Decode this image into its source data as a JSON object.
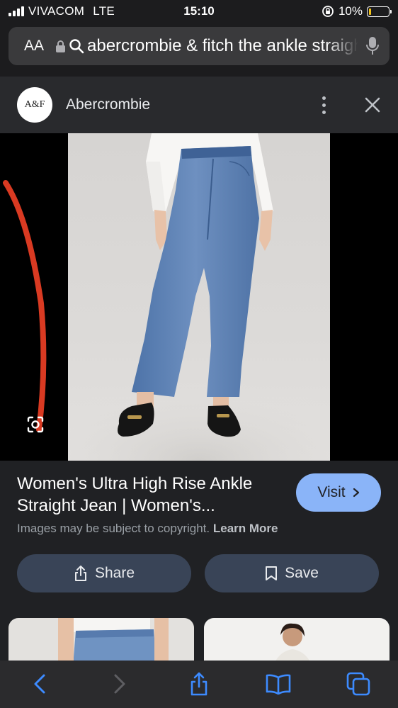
{
  "status": {
    "carrier": "VIVACOM",
    "network": "LTE",
    "time": "15:10",
    "battery": "10%",
    "battery_level": 0.1
  },
  "url_bar": {
    "aa_label": "AA",
    "query": "abercrombie & fitch the ankle straight jean"
  },
  "source": {
    "logo_text": "A&F",
    "name": "Abercrombie"
  },
  "result": {
    "title": "Women's Ultra High Rise Ankle Straight Jean | Women's...",
    "visit_label": "Visit",
    "copyright_text": "Images may be subject to copyright.",
    "learn_more": "Learn More",
    "share_label": "Share",
    "save_label": "Save"
  },
  "colors": {
    "accent": "#8ab4f8",
    "action_bg": "#394457",
    "annotation": "#d93a22"
  },
  "icons": [
    "lock-icon",
    "search-icon",
    "mic-icon",
    "more-icon",
    "close-icon",
    "lens-icon",
    "share-icon",
    "bookmark-icon",
    "back-icon",
    "forward-icon",
    "book-icon",
    "tabs-icon"
  ]
}
